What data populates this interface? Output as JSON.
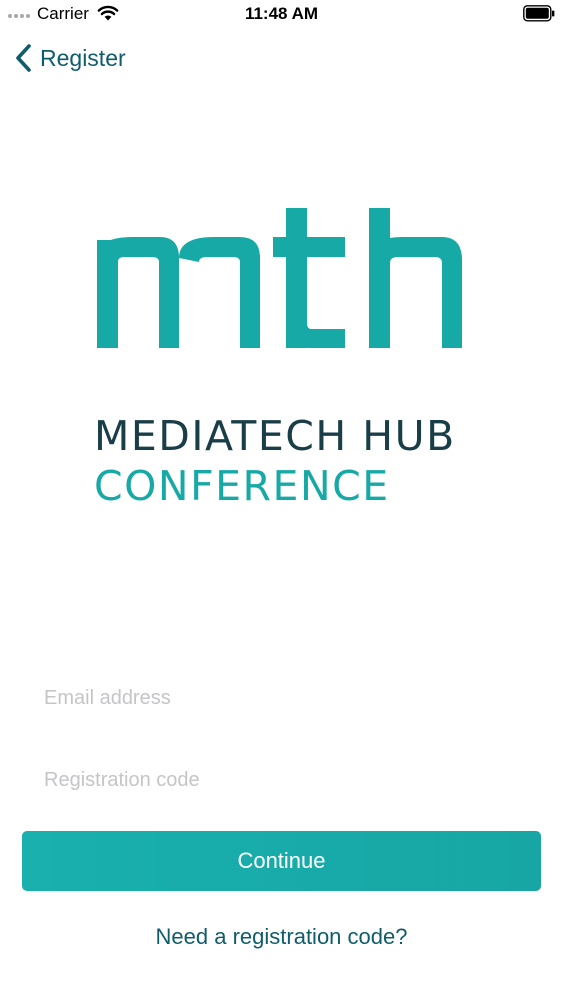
{
  "status_bar": {
    "carrier": "Carrier",
    "time": "11:48 AM"
  },
  "nav": {
    "back_label": "Register"
  },
  "logo": {
    "mark_text": "mth",
    "line1": "MEDIATECH HUB",
    "line2": "CONFERENCE"
  },
  "form": {
    "email_placeholder": "Email address",
    "email_value": "",
    "code_placeholder": "Registration code",
    "code_value": "",
    "continue_label": "Continue",
    "need_code_link": "Need a registration code?"
  },
  "colors": {
    "brand_teal": "#17a9a6",
    "brand_dark": "#1a3e48",
    "link": "#0f5d6b"
  }
}
